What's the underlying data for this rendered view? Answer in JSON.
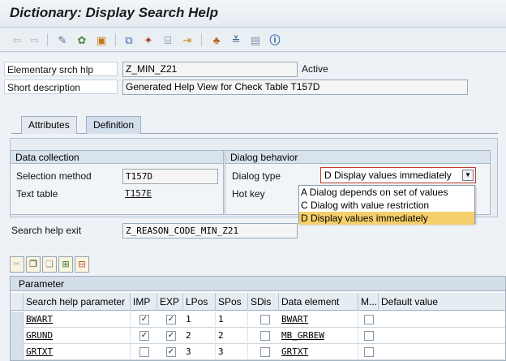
{
  "window": {
    "title": "Dictionary: Display Search Help"
  },
  "toolbar": {
    "icons": [
      "back-arrow-icon",
      "forward-arrow-icon",
      "other-object-icon",
      "display-change-icon",
      "activate-icon",
      "where-used-icon",
      "object-list-icon",
      "test-icon",
      "direct-entry-icon",
      "hierarchy-icon",
      "center-icon",
      "layout-icon",
      "info-icon"
    ]
  },
  "header": {
    "search_help_label": "Elementary srch hlp",
    "search_help_value": "Z_MIN_Z21",
    "status": "Active",
    "short_desc_label": "Short description",
    "short_desc_value": "Generated Help View for Check Table T157D"
  },
  "tabs": [
    {
      "label": "Attributes"
    },
    {
      "label": "Definition"
    }
  ],
  "data_collection": {
    "heading": "Data collection",
    "selection_method_label": "Selection method",
    "selection_method_value": "T157D",
    "text_table_label": "Text table",
    "text_table_value": "T157E"
  },
  "dialog_behavior": {
    "heading": "Dialog behavior",
    "dialog_type_label": "Dialog type",
    "dialog_type_value": "D Display values immediately",
    "hot_key_label": "Hot key",
    "options": [
      "A Dialog depends on set of values",
      "C Dialog with value restriction",
      "D Display values immediately"
    ]
  },
  "exit": {
    "label": "Search help exit",
    "value": "Z_REASON_CODE_MIN_Z21"
  },
  "parameter_grid": {
    "title": "Parameter",
    "columns": [
      "Search help parameter",
      "IMP",
      "EXP",
      "LPos",
      "SPos",
      "SDis",
      "Data element",
      "M...",
      "Default value"
    ],
    "rows": [
      {
        "param": "BWART",
        "imp": true,
        "exp": true,
        "lpos": "1",
        "spos": "1",
        "sdis": false,
        "data_element": "BWART",
        "m": false,
        "default": ""
      },
      {
        "param": "GRUND",
        "imp": true,
        "exp": true,
        "lpos": "2",
        "spos": "2",
        "sdis": false,
        "data_element": "MB_GRBEW",
        "m": false,
        "default": ""
      },
      {
        "param": "GRTXT",
        "imp": false,
        "exp": true,
        "lpos": "3",
        "spos": "3",
        "sdis": false,
        "data_element": "GRTXT",
        "m": false,
        "default": ""
      }
    ]
  }
}
